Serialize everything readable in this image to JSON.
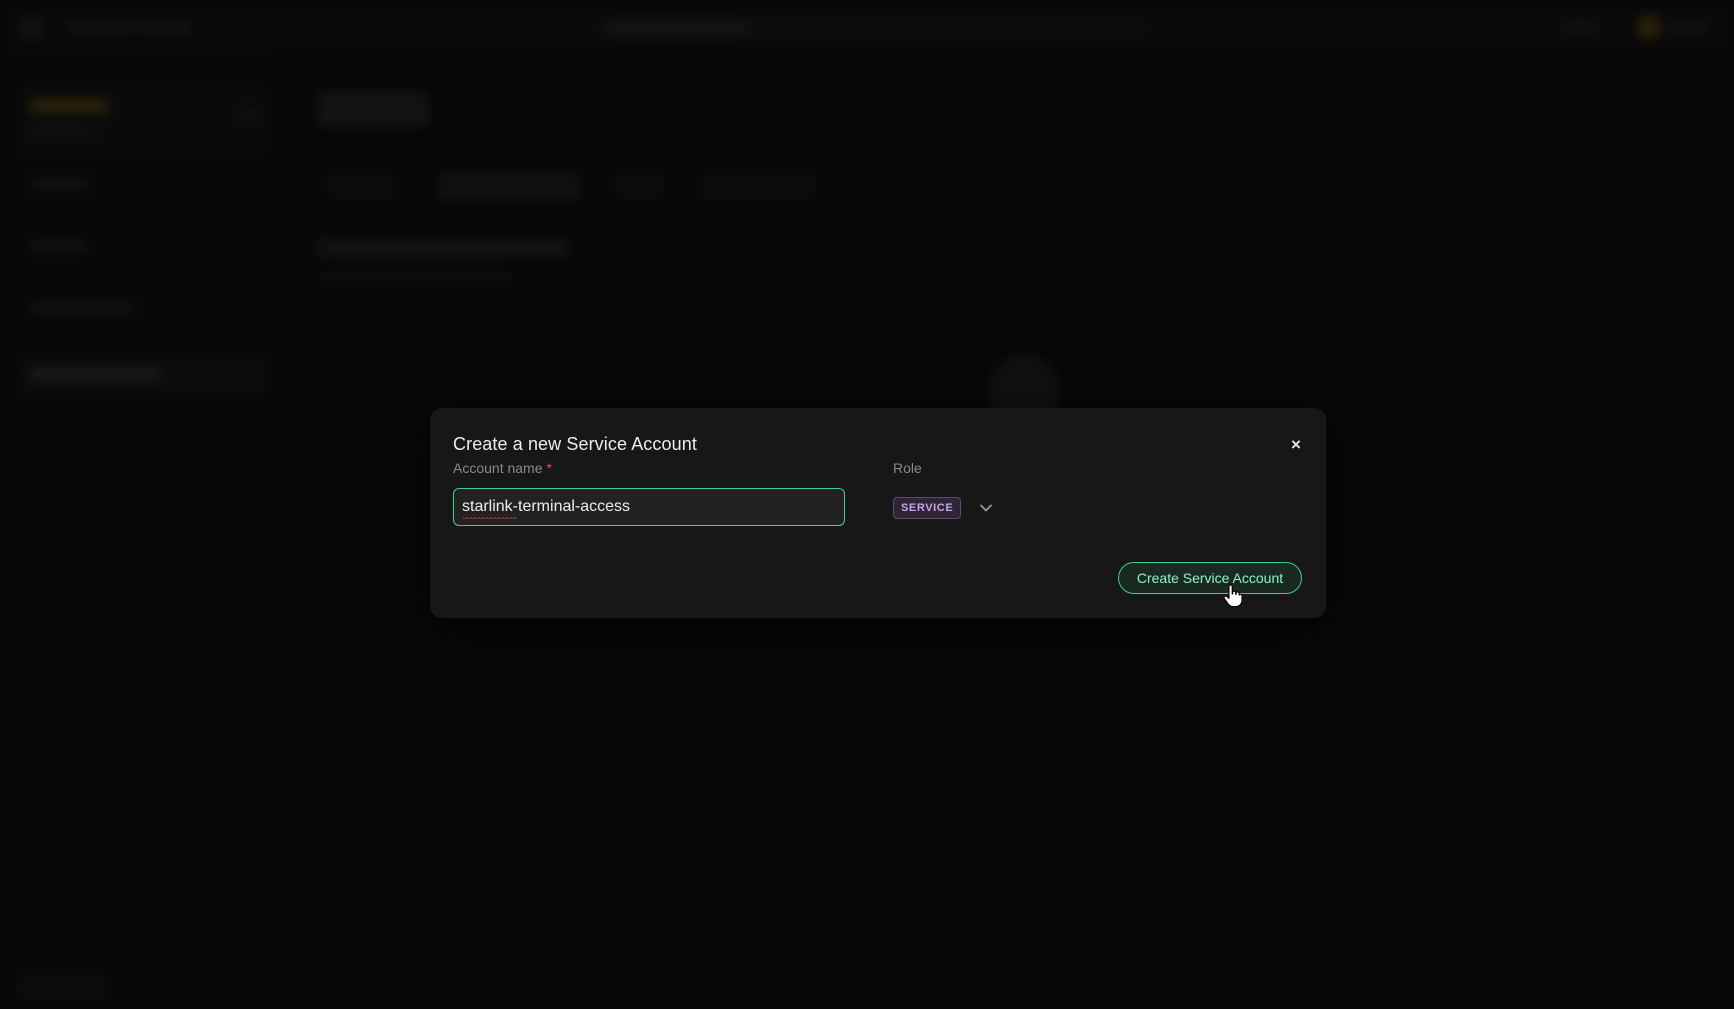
{
  "modal": {
    "title": "Create a new Service Account",
    "close_symbol": "×",
    "account_name": {
      "label": "Account name",
      "required_marker": "*",
      "value": "starlink-terminal-access"
    },
    "role": {
      "label": "Role",
      "selected": "SERVICE",
      "dropdown_icon": "chevron-down-icon"
    },
    "submit_label": "Create Service Account"
  },
  "colors": {
    "accent": "#3ecf8e",
    "required": "#e5484d",
    "role_badge": "#c7a6e8",
    "modal_bg": "#171717"
  }
}
